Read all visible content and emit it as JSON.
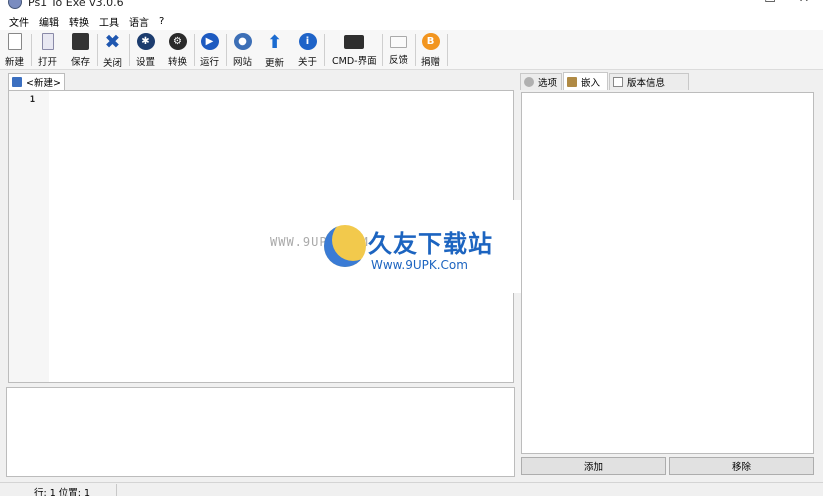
{
  "window": {
    "title": "Ps1 To Exe v3.0.6",
    "minimize": "—",
    "maximize": "☐",
    "close": "✕"
  },
  "menu": [
    "文件",
    "编辑",
    "转换",
    "工具",
    "语言",
    "?"
  ],
  "toolbar": {
    "new": "新建",
    "open": "打开",
    "save": "保存",
    "close": "关闭",
    "settings": "设置",
    "convert": "转换",
    "run": "运行",
    "website": "网站",
    "update": "更新",
    "about": "关于",
    "cmd": "CMD-界面",
    "feedback": "反馈",
    "donate": "捐赠"
  },
  "icons": {
    "close_glyph": "✖",
    "settings_glyph": "✱",
    "convert_glyph": "⚙",
    "run_glyph": "▶",
    "web_glyph": "●",
    "update_glyph": "⬆",
    "about_glyph": "i",
    "donate_glyph": "B"
  },
  "editor": {
    "tab_label": "<新建>",
    "line_numbers": [
      "1"
    ]
  },
  "right_panel": {
    "tabs": [
      "选项",
      "嵌入",
      "版本信息"
    ],
    "active_tab": "嵌入",
    "add_button": "添加",
    "remove_button": "移除"
  },
  "status": {
    "text": "行: 1  位置: 1"
  },
  "watermark": {
    "left": "WWW.9UPK.COM",
    "title": "久友下载站",
    "url": "Www.9UPK.Com"
  },
  "colors": {
    "accent": "#1c64c0",
    "donate": "#f2951f"
  }
}
